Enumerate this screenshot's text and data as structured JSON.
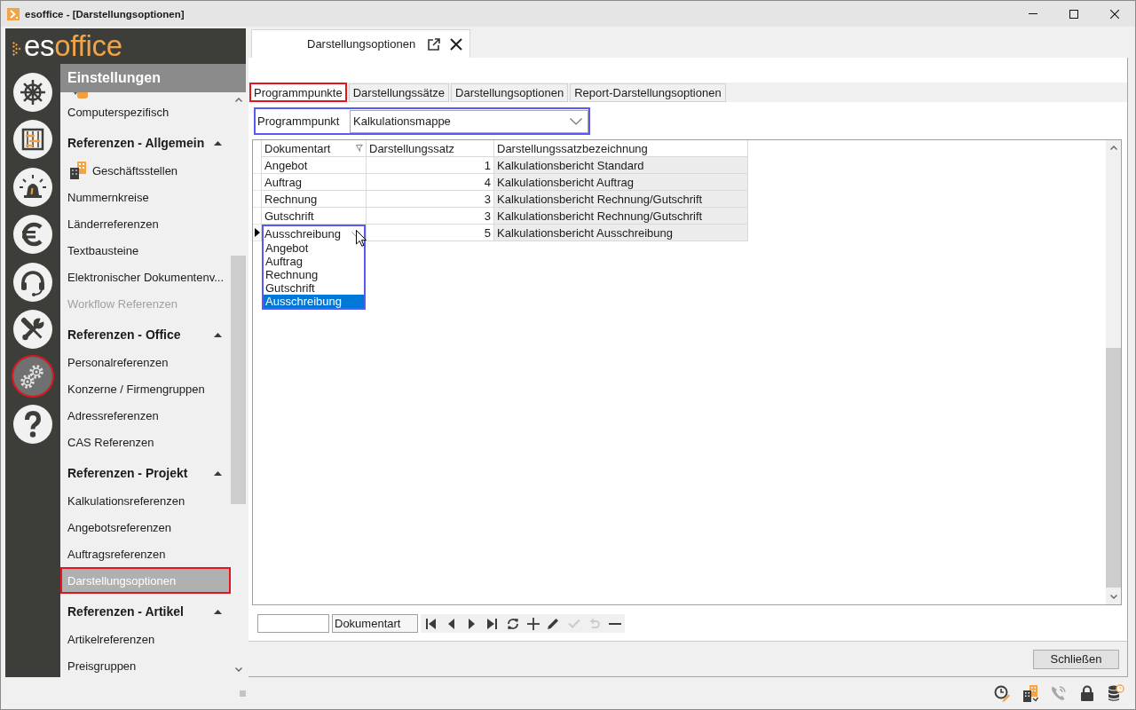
{
  "window": {
    "title": "esoffice - [Darstellungsoptionen]"
  },
  "logo": {
    "parts": [
      "es",
      "office"
    ]
  },
  "nav_rail": [
    {
      "kind": "helm",
      "selected": false,
      "highlighted": false
    },
    {
      "kind": "planner",
      "selected": false,
      "highlighted": false
    },
    {
      "kind": "siren",
      "selected": false,
      "highlighted": false
    },
    {
      "kind": "euro",
      "selected": false,
      "highlighted": false
    },
    {
      "kind": "headset",
      "selected": false,
      "highlighted": false
    },
    {
      "kind": "tools",
      "selected": false,
      "highlighted": false
    },
    {
      "kind": "gears",
      "selected": true,
      "highlighted": true
    },
    {
      "kind": "help",
      "selected": false,
      "highlighted": false
    }
  ],
  "sidebar": {
    "title": "Einstellungen",
    "items": [
      {
        "kind": "item",
        "label": "Computerspezifisch",
        "selected": false,
        "disabled": false,
        "highlighted": false
      }
    ],
    "sections": [
      {
        "title": "Referenzen - Allgemein",
        "expanded": true,
        "items": [
          {
            "kind": "icon_item",
            "label": "Geschäftsstellen",
            "selected": false,
            "disabled": false,
            "highlighted": false
          },
          {
            "kind": "item",
            "label": "Nummernkreise",
            "selected": false,
            "disabled": false,
            "highlighted": false
          },
          {
            "kind": "item",
            "label": "Länderreferenzen",
            "selected": false,
            "disabled": false,
            "highlighted": false
          },
          {
            "kind": "item",
            "label": "Textbausteine",
            "selected": false,
            "disabled": false,
            "highlighted": false
          },
          {
            "kind": "item",
            "label": "Elektronischer Dokumentenv...",
            "selected": false,
            "disabled": false,
            "highlighted": false
          },
          {
            "kind": "item",
            "label": "Workflow Referenzen",
            "selected": false,
            "disabled": true,
            "highlighted": false
          }
        ]
      },
      {
        "title": "Referenzen - Office",
        "expanded": true,
        "items": [
          {
            "kind": "item",
            "label": "Personalreferenzen",
            "selected": false,
            "disabled": false,
            "highlighted": false
          },
          {
            "kind": "item",
            "label": "Konzerne / Firmengruppen",
            "selected": false,
            "disabled": false,
            "highlighted": false
          },
          {
            "kind": "item",
            "label": "Adressreferenzen",
            "selected": false,
            "disabled": false,
            "highlighted": false
          },
          {
            "kind": "item",
            "label": "CAS Referenzen",
            "selected": false,
            "disabled": false,
            "highlighted": false
          }
        ]
      },
      {
        "title": "Referenzen - Projekt",
        "expanded": true,
        "items": [
          {
            "kind": "item",
            "label": "Kalkulationsreferenzen",
            "selected": false,
            "disabled": false,
            "highlighted": false
          },
          {
            "kind": "item",
            "label": "Angebotsreferenzen",
            "selected": false,
            "disabled": false,
            "highlighted": false
          },
          {
            "kind": "item",
            "label": "Auftragsreferenzen",
            "selected": false,
            "disabled": false,
            "highlighted": false
          },
          {
            "kind": "item",
            "label": "Darstellungsoptionen",
            "selected": true,
            "disabled": false,
            "highlighted": true
          }
        ]
      },
      {
        "title": "Referenzen - Artikel",
        "expanded": true,
        "items": [
          {
            "kind": "item",
            "label": "Artikelreferenzen",
            "selected": false,
            "disabled": false,
            "highlighted": false
          },
          {
            "kind": "item",
            "label": "Preisgruppen",
            "selected": false,
            "disabled": false,
            "highlighted": false
          }
        ]
      }
    ]
  },
  "document_tabs": [
    {
      "label": "Darstellungsoptionen",
      "selected": true
    }
  ],
  "tabs": [
    {
      "label": "Programmpunkte",
      "selected": true,
      "highlighted": true
    },
    {
      "label": "Darstellungssätze",
      "selected": false,
      "highlighted": false
    },
    {
      "label": "Darstellungsoptionen",
      "selected": false,
      "highlighted": false
    },
    {
      "label": "Report-Darstellungsoptionen",
      "selected": false,
      "highlighted": false
    }
  ],
  "filter": {
    "label": "Programmpunkt",
    "value": "Kalkulationsmappe",
    "highlighted": true
  },
  "table": {
    "columns": [
      {
        "label": "Dokumentart",
        "filter": true,
        "readonly": false
      },
      {
        "label": "Darstellungssatz",
        "filter": false,
        "readonly": false
      },
      {
        "label": "Darstellungssatzbezeichnung",
        "filter": false,
        "readonly": true
      }
    ],
    "rows": [
      {
        "cells": [
          "Angebot",
          "1",
          "Kalkulationsbericht Standard"
        ],
        "current": false
      },
      {
        "cells": [
          "Auftrag",
          "4",
          "Kalkulationsbericht Auftrag"
        ],
        "current": false
      },
      {
        "cells": [
          "Rechnung",
          "3",
          "Kalkulationsbericht Rechnung/Gutschrift"
        ],
        "current": false
      },
      {
        "cells": [
          "Gutschrift",
          "3",
          "Kalkulationsbericht Rechnung/Gutschrift"
        ],
        "current": false
      },
      {
        "cells": [
          "Ausschreibung",
          "5",
          "Kalkulationsbericht Ausschreibung"
        ],
        "current": true,
        "dropdown": {
          "highlighted": true,
          "options": [
            {
              "label": "Angebot",
              "selected": false
            },
            {
              "label": "Auftrag",
              "selected": false
            },
            {
              "label": "Rechnung",
              "selected": false
            },
            {
              "label": "Gutschrift",
              "selected": false
            },
            {
              "label": "Ausschreibung",
              "selected": true
            }
          ]
        }
      }
    ]
  },
  "toolbar": {
    "search_column": "Dokumentart",
    "buttons": [
      {
        "kind": "first",
        "disabled": false
      },
      {
        "kind": "previous",
        "disabled": false
      },
      {
        "kind": "next",
        "disabled": false
      },
      {
        "kind": "last",
        "disabled": false
      },
      {
        "kind": "refresh",
        "disabled": false
      },
      {
        "kind": "add",
        "disabled": false
      },
      {
        "kind": "edit",
        "disabled": false
      },
      {
        "kind": "save",
        "disabled": true
      },
      {
        "kind": "undo",
        "disabled": true
      },
      {
        "kind": "delete",
        "disabled": false
      }
    ]
  },
  "footer": {
    "close_button": "Schließen"
  },
  "status_bar": {
    "icons": [
      {
        "kind": "clock",
        "disabled": false
      },
      {
        "kind": "buildings",
        "disabled": false
      },
      {
        "kind": "phone",
        "disabled": true
      },
      {
        "kind": "lock",
        "disabled": false
      },
      {
        "kind": "database",
        "disabled": false
      }
    ]
  }
}
